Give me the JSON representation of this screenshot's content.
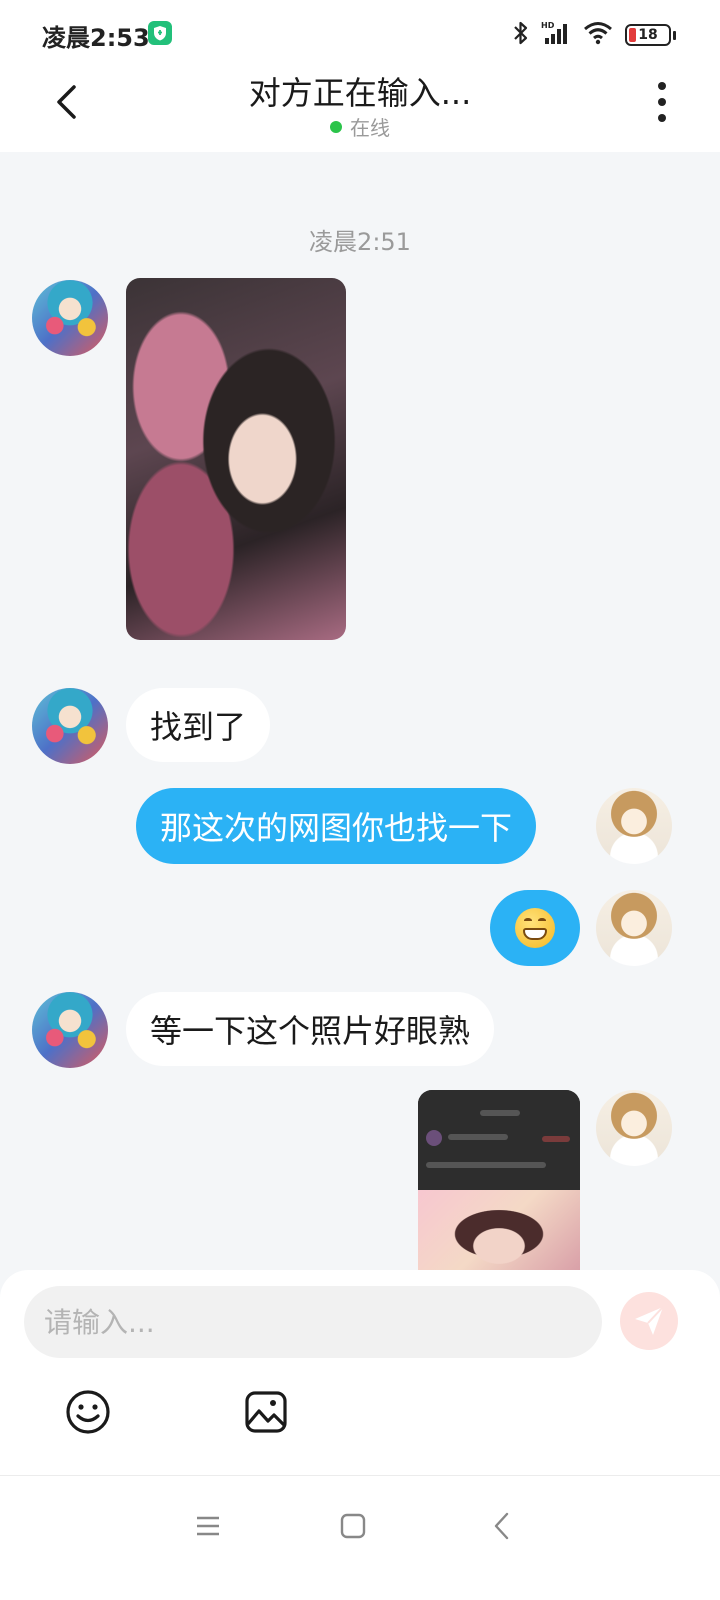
{
  "status_bar": {
    "time": "凌晨2:53",
    "battery_level": "18",
    "icons": [
      "shield-icon",
      "bluetooth-icon",
      "signal-icon",
      "wifi-icon",
      "battery-icon"
    ]
  },
  "header": {
    "title": "对方正在输入...",
    "status": "在线",
    "status_color": "#2bc44a"
  },
  "chat": {
    "timestamp": "凌晨2:51",
    "messages": [
      {
        "from": "other",
        "type": "image"
      },
      {
        "from": "other",
        "type": "text",
        "text": "找到了"
      },
      {
        "from": "self",
        "type": "text",
        "text": "那这次的网图你也找一下"
      },
      {
        "from": "self",
        "type": "emoji",
        "emoji": "grinning-face"
      },
      {
        "from": "other",
        "type": "text",
        "text": "等一下这个照片好眼熟"
      },
      {
        "from": "self",
        "type": "image"
      }
    ]
  },
  "input": {
    "placeholder": "请输入..."
  },
  "colors": {
    "accent": "#2bb2f5",
    "background": "#f4f6f8",
    "send_button": "#fde1de"
  }
}
